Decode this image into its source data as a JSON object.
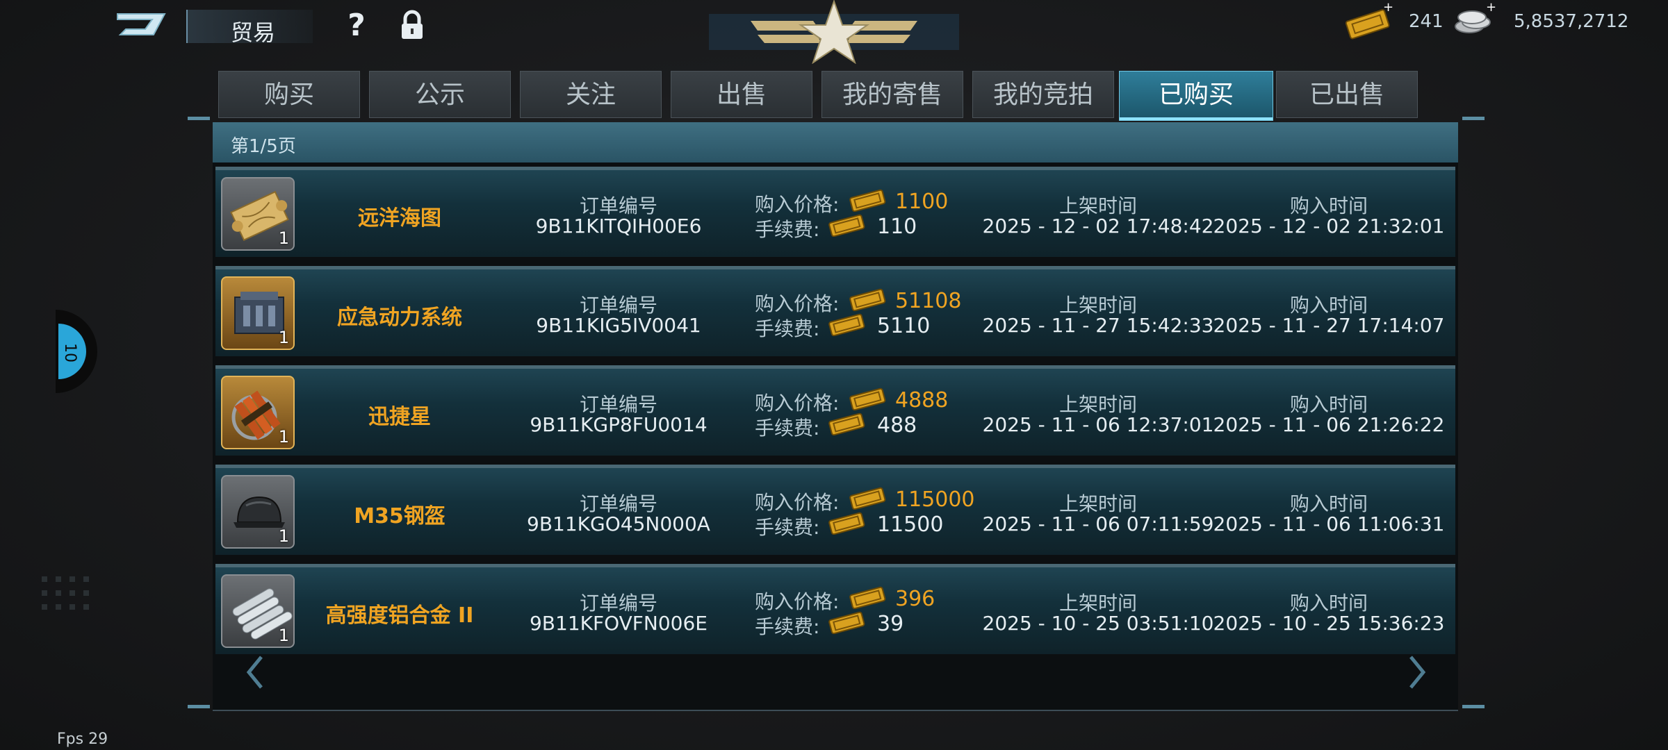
{
  "header": {
    "title": "贸易",
    "help_icon": "question-mark-icon",
    "lock_icon": "lock-icon",
    "currencies": [
      {
        "icon": "ticket-icon",
        "value": "241"
      },
      {
        "icon": "silver-coins-icon",
        "value": "5,8537,2712"
      }
    ]
  },
  "tabs": [
    {
      "label": "购买",
      "active": false
    },
    {
      "label": "公示",
      "active": false
    },
    {
      "label": "关注",
      "active": false
    },
    {
      "label": "出售",
      "active": false
    },
    {
      "label": "我的寄售",
      "active": false
    },
    {
      "label": "我的竞拍",
      "active": false
    },
    {
      "label": "已购买",
      "active": true
    },
    {
      "label": "已出售",
      "active": false
    }
  ],
  "page_indicator": "第1/5页",
  "labels": {
    "order_no": "订单编号",
    "price": "购入价格:",
    "fee": "手续费:",
    "listed_time": "上架时间",
    "bought_time": "购入时间"
  },
  "rows": [
    {
      "name": "远洋海图",
      "icon": "sea-chart-scroll-icon",
      "qty": "1",
      "order_no": "9B11KITQIH00E6",
      "price": "1100",
      "fee": "110",
      "listed": "2025 - 12 - 02 17:48:42",
      "bought": "2025 - 12 - 02 21:32:01"
    },
    {
      "name": "应急动力系统",
      "icon": "engine-icon",
      "qty": "1",
      "order_no": "9B11KIG5IV0041",
      "price": "51108",
      "fee": "5110",
      "listed": "2025 - 11 - 27 15:42:33",
      "bought": "2025 - 11 - 27 17:14:07"
    },
    {
      "name": "迅捷星",
      "icon": "dynamite-bundle-icon",
      "qty": "1",
      "order_no": "9B11KGP8FU0014",
      "price": "4888",
      "fee": "488",
      "listed": "2025 - 11 - 06 12:37:01",
      "bought": "2025 - 11 - 06 21:26:22"
    },
    {
      "name": "M35钢盔",
      "icon": "steel-helmet-icon",
      "qty": "1",
      "order_no": "9B11KGO45N000A",
      "price": "115000",
      "fee": "11500",
      "listed": "2025 - 11 - 06 07:11:59",
      "bought": "2025 - 11 - 06 11:06:31"
    },
    {
      "name": "高强度铝合金 II",
      "icon": "aluminum-rods-icon",
      "qty": "1",
      "order_no": "9B11KFOVFN006E",
      "price": "396",
      "fee": "39",
      "listed": "2025 - 10 - 25 03:51:10",
      "bought": "2025 - 10 - 25 15:36:23"
    }
  ],
  "footer": {
    "fps": "Fps 29"
  },
  "colors": {
    "accent": "#f0a422",
    "tab_active": "#2f7e9a",
    "row_bg": "#13303b"
  }
}
